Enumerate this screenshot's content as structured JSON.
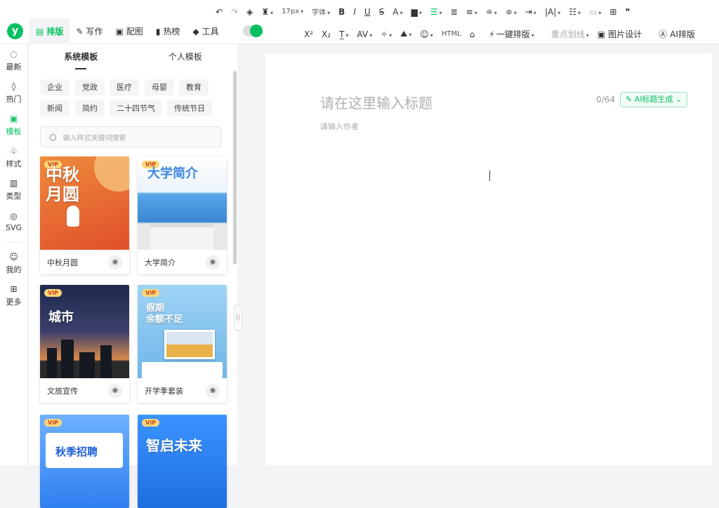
{
  "nav": {
    "tabs": [
      {
        "label": "排版",
        "icon": "layout-icon"
      },
      {
        "label": "写作",
        "icon": "pen-icon"
      },
      {
        "label": "配图",
        "icon": "image-icon"
      },
      {
        "label": "热榜",
        "icon": "bookmark-icon"
      },
      {
        "label": "工具",
        "icon": "cube-icon"
      }
    ],
    "toggle_on": true
  },
  "toolbar": {
    "font_size": "17px",
    "font_family": "字体",
    "one_click": "一键排版",
    "highlight": "重点划线",
    "image_design": "图片设计",
    "ai_layout": "AI排版"
  },
  "sidebar": {
    "items": [
      {
        "label": "最新",
        "icon": "chat-icon"
      },
      {
        "label": "热门",
        "icon": "flame-icon"
      },
      {
        "label": "模板",
        "icon": "template-icon"
      },
      {
        "label": "样式",
        "icon": "style-icon"
      },
      {
        "label": "类型",
        "icon": "book-icon"
      },
      {
        "label": "SVG",
        "icon": "svg-icon"
      },
      {
        "label": "我的",
        "icon": "user-icon"
      },
      {
        "label": "更多",
        "icon": "grid-icon"
      }
    ]
  },
  "panel": {
    "tabs": [
      "系统模板",
      "个人模板"
    ],
    "tags": [
      "企业",
      "党政",
      "医疗",
      "母婴",
      "教育",
      "新闻",
      "简约",
      "二十四节气",
      "传统节日"
    ],
    "search_placeholder": "输入样式关键词搜索",
    "cards": [
      {
        "title": "中秋月圆",
        "art": "中秋\n月圆",
        "vip": "VIP",
        "bg": "#ee6a2c"
      },
      {
        "title": "大学简介",
        "art": "大学简介",
        "vip": "VIP",
        "bg": "#3d8fdb"
      },
      {
        "title": "文旅宣传",
        "art": "城市",
        "vip": "VIP",
        "bg": "#2f3558"
      },
      {
        "title": "开学季套装",
        "art": "假期\n余额不足",
        "vip": "VIP",
        "bg": "#8ec8ef"
      },
      {
        "title": "",
        "art": "秋季招聘",
        "vip": "VIP",
        "bg": "#3e8cf0"
      },
      {
        "title": "",
        "art": "智启未来",
        "vip": "VIP",
        "bg": "#2a7fe5"
      }
    ]
  },
  "editor": {
    "title_placeholder": "请在这里输入标题",
    "author_placeholder": "请输入作者",
    "counter": "0/64",
    "ai_title_button": "AI标题生成"
  }
}
